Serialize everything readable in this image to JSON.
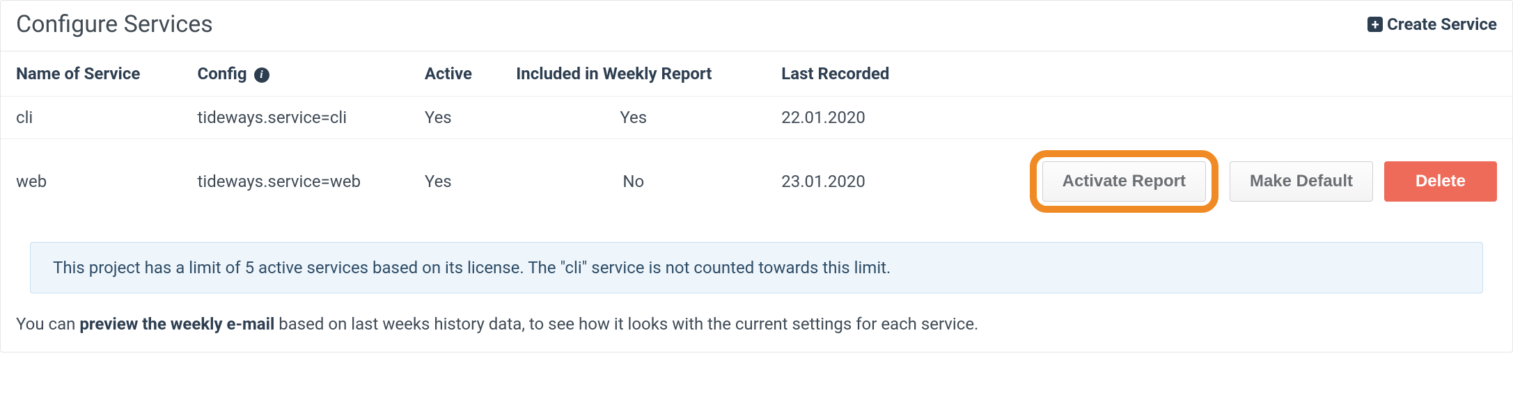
{
  "header": {
    "title": "Configure Services",
    "create_label": "Create Service"
  },
  "table": {
    "columns": {
      "name": "Name of Service",
      "config": "Config",
      "active": "Active",
      "weekly": "Included in Weekly Report",
      "last": "Last Recorded"
    },
    "rows": [
      {
        "name": "cli",
        "config": "tideways.service=cli",
        "active": "Yes",
        "weekly": "Yes",
        "last": "22.01.2020"
      },
      {
        "name": "web",
        "config": "tideways.service=web",
        "active": "Yes",
        "weekly": "No",
        "last": "23.01.2020"
      }
    ]
  },
  "actions": {
    "activate_report": "Activate Report",
    "make_default": "Make Default",
    "delete": "Delete"
  },
  "info_box": "This project has a limit of 5 active services based on its license. The \"cli\" service is not counted towards this limit.",
  "footer": {
    "prefix": "You can ",
    "link": "preview the weekly e-mail",
    "suffix": " based on last weeks history data, to see how it looks with the current settings for each service."
  }
}
